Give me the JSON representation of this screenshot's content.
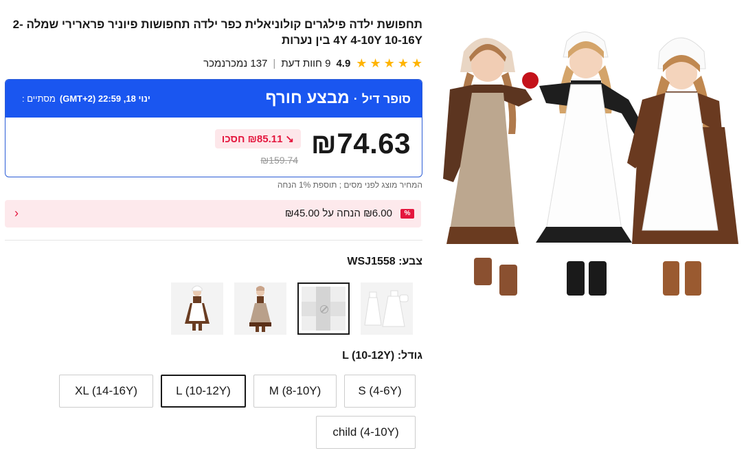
{
  "product": {
    "title": "תחפושת ילדה פילגרים קולוניאלית כפר ילדה תחפושות פיוניר פרארירי שמלה -2 4Y 4-10Y 10-16Y בין נערות",
    "rating": "4.9",
    "reviews": "9 חוות דעת",
    "sold": "137 נמכרנמכר",
    "separator": "|"
  },
  "deal": {
    "main_label": "מבצע חורף",
    "dot": "·",
    "sub_label": "סופר דיל",
    "ends_label": "מסתיים :",
    "ends_value": "ינוי 18, 22:59 (GMT+2)",
    "price": "₪74.63",
    "save_text": "₪85.11 חסכו",
    "save_arrow": "↘",
    "original_price": "₪159.74"
  },
  "tax_note": "המחיר מוצג לפני מסים ; תוספת 1% הנחה",
  "coupon": {
    "tag": "%",
    "text": "₪6.00 הנחה על ₪45.00",
    "arrow": "›"
  },
  "color": {
    "label": "צבע:",
    "value": "WSJ1558",
    "swatches": [
      "white-apron-set",
      "placeholder",
      "brown-tan-dress",
      "brown-white-dress"
    ],
    "selected_index": 1
  },
  "size": {
    "label": "גודל:",
    "value": "L (10-12Y)",
    "options": [
      "S (4-6Y)",
      "M (8-10Y)",
      "L (10-12Y)",
      "XL (14-16Y)",
      "child (4-10Y)"
    ],
    "selected": "L (10-12Y)"
  },
  "colors": {
    "deal_blue": "#1a56f0",
    "sale_red": "#e4173e",
    "star": "#ffb400"
  }
}
